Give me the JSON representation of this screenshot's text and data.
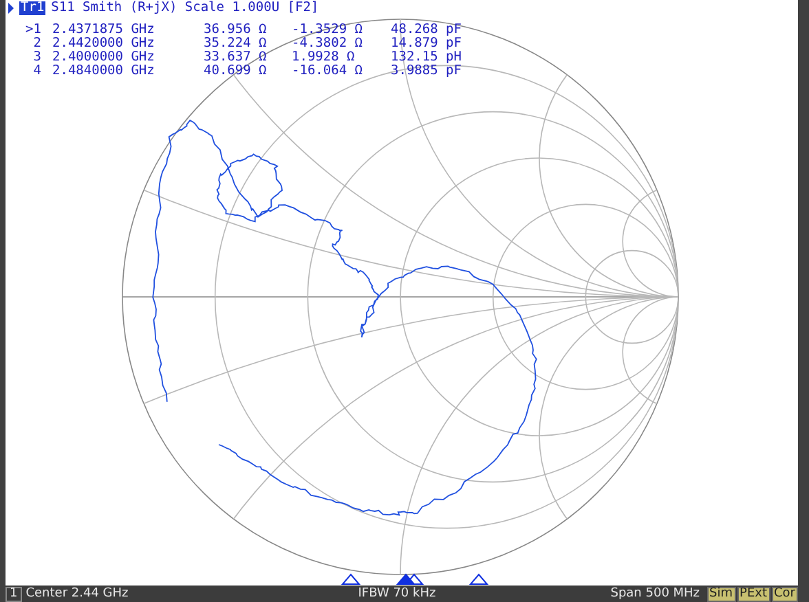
{
  "trace": {
    "tab": "Tr1",
    "title": "S11 Smith (R+jX) Scale 1.000U [F2]"
  },
  "markers": [
    {
      "label": ">1",
      "freq": "2.4371875 GHz",
      "resistance": "36.956 Ω",
      "reactance": "-1.3529 Ω",
      "value": "48.268 pF",
      "selected": true
    },
    {
      "label": "2",
      "freq": "2.4420000 GHz",
      "resistance": "35.224 Ω",
      "reactance": "-4.3802 Ω",
      "value": "14.879 pF",
      "selected": false
    },
    {
      "label": "3",
      "freq": "2.4000000 GHz",
      "resistance": "33.637 Ω",
      "reactance": "1.9928 Ω",
      "value": "132.15 pH",
      "selected": false
    },
    {
      "label": "4",
      "freq": "2.4840000 GHz",
      "resistance": "40.699 Ω",
      "reactance": "-16.064 Ω",
      "value": "3.9885 pF",
      "selected": false
    }
  ],
  "status": {
    "channel": "1",
    "center": "Center 2.44 GHz",
    "ifbw": "IFBW 70 kHz",
    "span": "Span 500 MHz",
    "badges": [
      "Sim",
      "PExt",
      "Cor"
    ]
  }
}
